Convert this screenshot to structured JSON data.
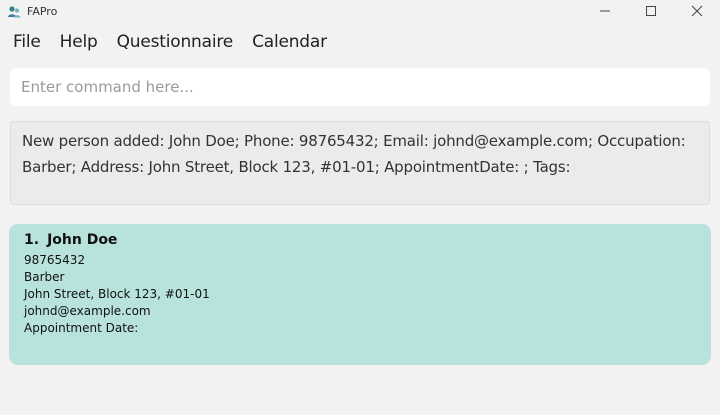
{
  "window": {
    "title": "FAPro",
    "icon": "people-icon",
    "controls": {
      "minimize": "—",
      "maximize": "☐",
      "close": "✕"
    }
  },
  "menu": {
    "items": [
      {
        "label": "File"
      },
      {
        "label": "Help"
      },
      {
        "label": "Questionnaire"
      },
      {
        "label": "Calendar"
      }
    ]
  },
  "command": {
    "placeholder": "Enter command here...",
    "value": ""
  },
  "result": {
    "text": "New person added: John Doe; Phone: 98765432; Email: johnd@example.com; Occupation: Barber; Address: John Street, Block 123, #01-01; AppointmentDate: ; Tags:"
  },
  "persons": [
    {
      "index": "1.",
      "name": "John Doe",
      "phone": "98765432",
      "occupation": "Barber",
      "address": "John Street, Block 123, #01-01",
      "email": "johnd@example.com",
      "appointment": "Appointment Date:"
    }
  ],
  "colors": {
    "background": "#f2f2f2",
    "card": "#b8e3dd",
    "result_box": "#ebebeb",
    "command_box": "#ffffff"
  }
}
